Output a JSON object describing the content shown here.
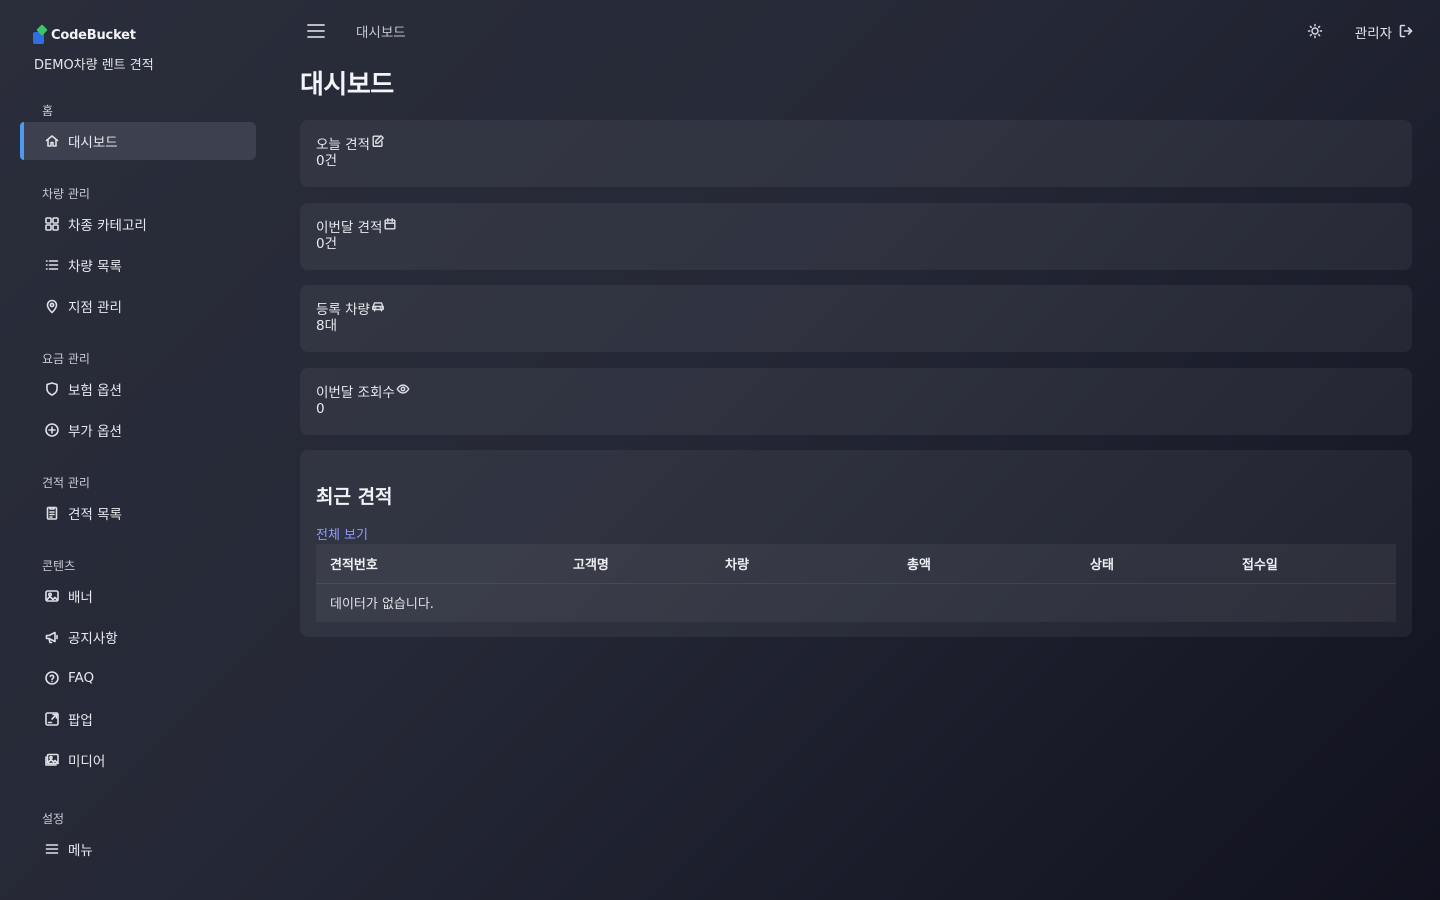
{
  "brand": {
    "logo_text": "CodeBucket",
    "subtitle": "DEMO차량 렌트 견적"
  },
  "sidebar": {
    "sections": [
      {
        "title": "홈",
        "items": [
          {
            "label": "대시보드",
            "icon": "home-icon",
            "active": true
          }
        ]
      },
      {
        "title": "차량 관리",
        "items": [
          {
            "label": "차종 카테고리",
            "icon": "grid-icon"
          },
          {
            "label": "차량 목록",
            "icon": "list-icon"
          },
          {
            "label": "지점 관리",
            "icon": "map-pin-icon"
          }
        ]
      },
      {
        "title": "요금 관리",
        "items": [
          {
            "label": "보험 옵션",
            "icon": "shield-icon"
          },
          {
            "label": "부가 옵션",
            "icon": "plus-circle-icon"
          }
        ]
      },
      {
        "title": "견적 관리",
        "items": [
          {
            "label": "견적 목록",
            "icon": "clipboard-icon"
          }
        ]
      },
      {
        "title": "콘텐츠",
        "items": [
          {
            "label": "배너",
            "icon": "image-icon"
          },
          {
            "label": "공지사항",
            "icon": "megaphone-icon"
          },
          {
            "label": "FAQ",
            "icon": "help-circle-icon"
          },
          {
            "label": "팝업",
            "icon": "popup-icon"
          },
          {
            "label": "미디어",
            "icon": "images-icon"
          }
        ]
      },
      {
        "title": "설정",
        "items": [
          {
            "label": "메뉴",
            "icon": "menu-icon"
          }
        ]
      }
    ]
  },
  "topbar": {
    "breadcrumb": "대시보드",
    "user": "관리자"
  },
  "page": {
    "title": "대시보드"
  },
  "stats": [
    {
      "label": "오늘 견적",
      "value": "0건",
      "icon": "edit-icon"
    },
    {
      "label": "이번달 견적",
      "value": "0건",
      "icon": "calendar-icon"
    },
    {
      "label": "등록 차량",
      "value": "8대",
      "icon": "car-icon"
    },
    {
      "label": "이번달 조회수",
      "value": "0",
      "icon": "eye-icon"
    }
  ],
  "recent": {
    "title": "최근 견적",
    "view_all": "전체 보기",
    "columns": [
      "견적번호",
      "고객명",
      "차량",
      "총액",
      "상태",
      "접수일"
    ],
    "empty_text": "데이터가 없습니다."
  },
  "colors": {
    "accent": "#4c9bf0",
    "link": "#8f9bff",
    "active_bg": "#3d404f"
  }
}
